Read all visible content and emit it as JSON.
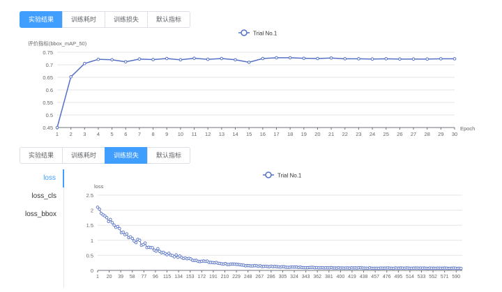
{
  "tabs_top": [
    {
      "label": "实验结果",
      "active": true
    },
    {
      "label": "训练耗时",
      "active": false
    },
    {
      "label": "训练损失",
      "active": false
    },
    {
      "label": "默认指标",
      "active": false
    }
  ],
  "tabs_bottom": [
    {
      "label": "实验结果",
      "active": false
    },
    {
      "label": "训练耗时",
      "active": false
    },
    {
      "label": "训练损失",
      "active": true
    },
    {
      "label": "默认指标",
      "active": false
    }
  ],
  "side_menu": [
    {
      "label": "loss",
      "active": true
    },
    {
      "label": "loss_cls",
      "active": false
    },
    {
      "label": "loss_bbox",
      "active": false
    }
  ],
  "colors": {
    "accent": "#409eff",
    "series": "#5470c6"
  },
  "chart_data": [
    {
      "type": "line",
      "legend": [
        "Trial No.1"
      ],
      "legend_position": "top-center",
      "ylabel": "评价指标(bbox_mAP_50)",
      "xlabel": "Epoch",
      "ylim": [
        0.45,
        0.75
      ],
      "yticks": [
        "0.45",
        "0.5",
        "0.55",
        "0.6",
        "0.65",
        "0.7",
        "0.75"
      ],
      "x": [
        1,
        2,
        3,
        4,
        5,
        6,
        7,
        8,
        9,
        10,
        11,
        12,
        13,
        14,
        15,
        16,
        17,
        18,
        19,
        20,
        21,
        22,
        23,
        24,
        25,
        26,
        27,
        28,
        29,
        30
      ],
      "series": [
        {
          "name": "Trial No.1",
          "values": [
            0.45,
            0.652,
            0.705,
            0.722,
            0.72,
            0.712,
            0.723,
            0.721,
            0.725,
            0.72,
            0.726,
            0.722,
            0.725,
            0.72,
            0.71,
            0.725,
            0.728,
            0.728,
            0.726,
            0.725,
            0.727,
            0.724,
            0.724,
            0.723,
            0.724,
            0.723,
            0.723,
            0.723,
            0.724,
            0.724
          ]
        }
      ],
      "grid": true
    },
    {
      "type": "line",
      "legend": [
        "Trial No.1"
      ],
      "legend_position": "top-center",
      "ylabel": "loss",
      "ylim": [
        0,
        2.5
      ],
      "yticks": [
        "0",
        "0.5",
        "1",
        "1.5",
        "2",
        "2.5"
      ],
      "xticks": [
        "1",
        "20",
        "39",
        "58",
        "77",
        "96",
        "115",
        "134",
        "153",
        "172",
        "191",
        "210",
        "229",
        "248",
        "267",
        "286",
        "305",
        "324",
        "343",
        "362",
        "381",
        "400",
        "419",
        "438",
        "457",
        "476",
        "495",
        "514",
        "533",
        "552",
        "571",
        "590"
      ],
      "x_range": [
        1,
        600
      ],
      "series": [
        {
          "name": "Trial No.1",
          "curve": {
            "start": 2.1,
            "floor": 0.07,
            "decay_per_step": 0.0125,
            "noise_amplitude": 0.08
          }
        }
      ],
      "grid": true
    }
  ]
}
